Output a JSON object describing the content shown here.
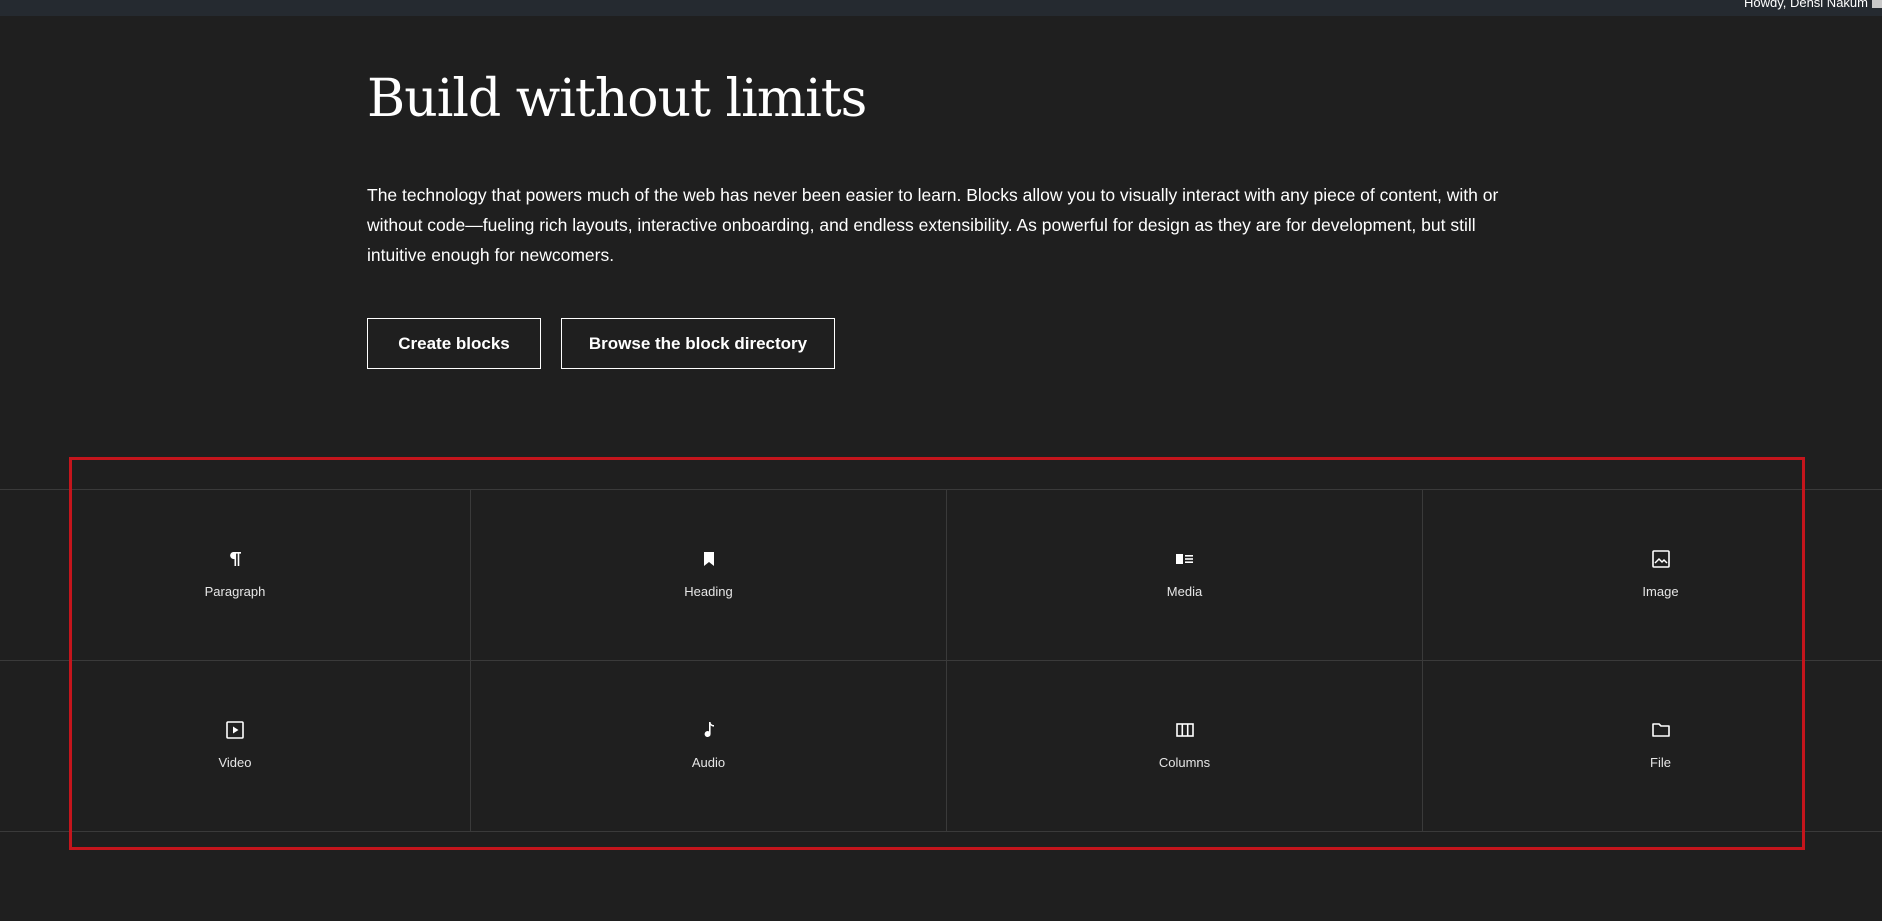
{
  "admin_bar": {
    "greeting": "Howdy, Densi Nakum"
  },
  "hero": {
    "title": "Build without limits",
    "description": "The technology that powers much of the web has never been easier to learn. Blocks allow you to visually interact with any piece of content, with or without code—fueling rich layouts, interactive onboarding, and endless extensibility. As powerful for design as they are for development, but still intuitive enough for newcomers."
  },
  "buttons": {
    "create": "Create blocks",
    "browse": "Browse the block directory"
  },
  "blocks": [
    {
      "label": "Paragraph",
      "icon": "paragraph-icon"
    },
    {
      "label": "Heading",
      "icon": "bookmark-icon"
    },
    {
      "label": "Media",
      "icon": "media-text-icon"
    },
    {
      "label": "Image",
      "icon": "image-icon"
    },
    {
      "label": "Video",
      "icon": "video-icon"
    },
    {
      "label": "Audio",
      "icon": "music-note-icon"
    },
    {
      "label": "Columns",
      "icon": "columns-icon"
    },
    {
      "label": "File",
      "icon": "folder-icon"
    }
  ],
  "colors": {
    "background": "#1f1f1f",
    "admin_bar": "#252a30",
    "text": "#ffffff",
    "grid_lines": "#3a3a3a",
    "highlight": "#c4151c"
  }
}
